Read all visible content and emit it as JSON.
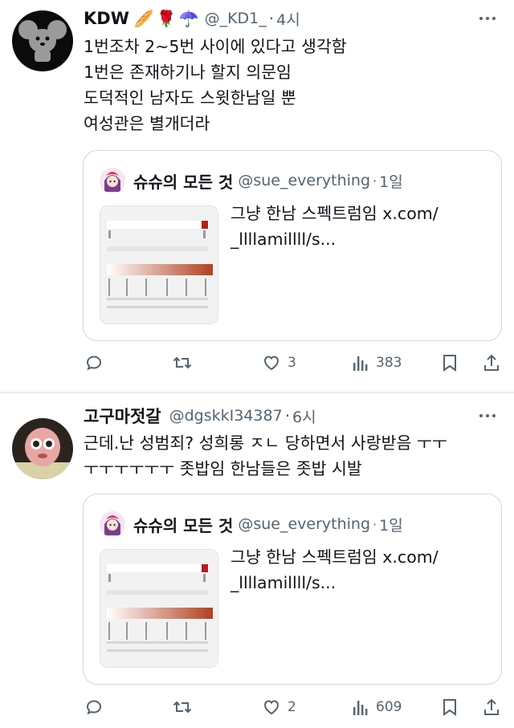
{
  "tweets": [
    {
      "name": "KDW",
      "emojis": [
        "🥖",
        "🌹",
        "☂️"
      ],
      "handle": "@_KD1_",
      "time": "4시",
      "lines": [
        "1번조차 2~5번 사이에 있다고 생각함",
        "1번은 존재하기나 할지 의문임",
        "도덕적인 남자도 스윗한남일 뿐",
        "여성관은 별개더라"
      ],
      "quote": {
        "name": "슈슈의 모든 것",
        "handle": "@sue_everything",
        "time": "1일",
        "text_lines": [
          "그냥 한남 스펙트럼임 x.com/",
          "_llllamillll/s..."
        ]
      },
      "actions": {
        "reply": "",
        "retweet": "",
        "like": "3",
        "views": "383"
      }
    },
    {
      "name": "고구마젓갈",
      "emojis": [],
      "handle": "@dgskkI34387",
      "time": "6시",
      "lines": [
        "근데.난 성범죄? 성희롱 ㅈㄴ 당하면서 사랑받음 ㅜㅜ",
        "ㅜㅜㅜㅜㅜㅜ 좃밥임 한남들은 좃밥 시발"
      ],
      "quote": {
        "name": "슈슈의 모든 것",
        "handle": "@sue_everything",
        "time": "1일",
        "text_lines": [
          "그냥 한남 스펙트럼임 x.com/",
          "_llllamillll/s..."
        ]
      },
      "actions": {
        "reply": "",
        "retweet": "",
        "like": "2",
        "views": "609"
      }
    }
  ],
  "colors": {
    "text": "#0f1419",
    "secondary": "#536471",
    "border": "#cfd9de"
  },
  "icons": [
    "reply-icon",
    "retweet-icon",
    "like-icon",
    "views-icon",
    "bookmark-icon",
    "share-icon",
    "more-icon"
  ]
}
